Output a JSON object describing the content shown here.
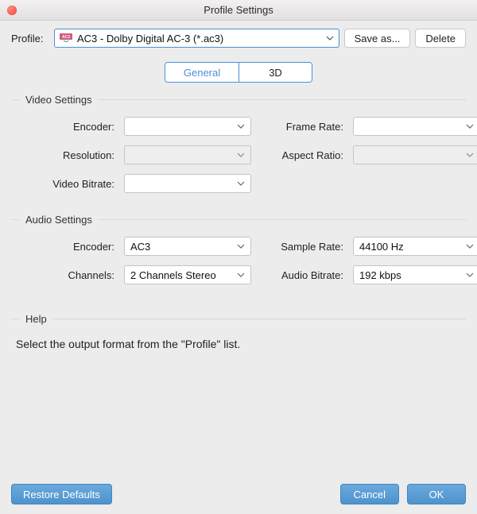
{
  "window": {
    "title": "Profile Settings"
  },
  "profile": {
    "label": "Profile:",
    "icon": "ac3-format-icon",
    "value": "AC3 - Dolby Digital AC-3 (*.ac3)",
    "save_as_label": "Save as...",
    "delete_label": "Delete"
  },
  "tabs": {
    "general": "General",
    "three_d": "3D",
    "active": "general"
  },
  "video": {
    "title": "Video Settings",
    "encoder_label": "Encoder:",
    "encoder_value": "",
    "framerate_label": "Frame Rate:",
    "framerate_value": "",
    "resolution_label": "Resolution:",
    "resolution_value": "",
    "aspect_label": "Aspect Ratio:",
    "aspect_value": "",
    "bitrate_label": "Video Bitrate:",
    "bitrate_value": ""
  },
  "audio": {
    "title": "Audio Settings",
    "encoder_label": "Encoder:",
    "encoder_value": "AC3",
    "samplerate_label": "Sample Rate:",
    "samplerate_value": "44100 Hz",
    "channels_label": "Channels:",
    "channels_value": "2 Channels Stereo",
    "bitrate_label": "Audio Bitrate:",
    "bitrate_value": "192 kbps"
  },
  "help": {
    "title": "Help",
    "text": "Select the output format from the \"Profile\" list."
  },
  "footer": {
    "restore_label": "Restore Defaults",
    "cancel_label": "Cancel",
    "ok_label": "OK"
  },
  "colors": {
    "accent": "#4a90d9",
    "bg": "#ececec"
  }
}
